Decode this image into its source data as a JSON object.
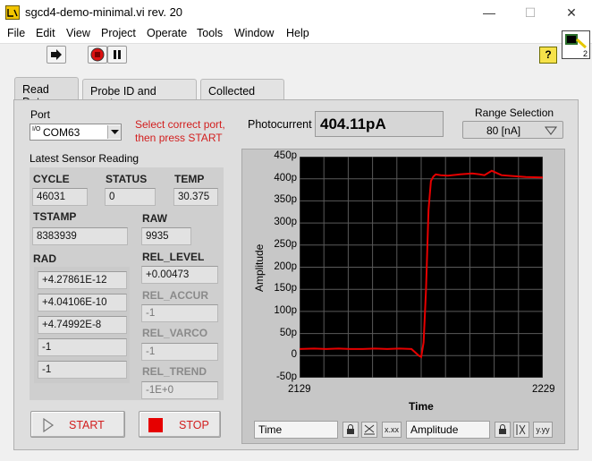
{
  "window": {
    "title": "sgcd4-demo-minimal.vi rev. 20",
    "minimize": "—",
    "maximize": "☐",
    "close": "✕"
  },
  "menu": [
    "File",
    "Edit",
    "View",
    "Project",
    "Operate",
    "Tools",
    "Window",
    "Help"
  ],
  "toolbar": {
    "help": "?",
    "icon_connector": "2"
  },
  "tabs": [
    "Read Data",
    "Probe ID and Settings",
    "Collected Data"
  ],
  "port": {
    "label": "Port",
    "value": "COM63",
    "io_glyph": "I/O",
    "hint": "Select correct port,\nthen press START"
  },
  "photocurrent": {
    "label": "Photocurrent",
    "value": "404.11pA"
  },
  "range": {
    "label": "Range Selection",
    "value": "80 [nA]"
  },
  "sensor": {
    "section_label": "Latest Sensor Reading",
    "cycle_label": "CYCLE",
    "cycle": "46031",
    "status_label": "STATUS",
    "status": "0",
    "temp_label": "TEMP",
    "temp": "30.375",
    "tstamp_label": "TSTAMP",
    "tstamp": "8383939",
    "raw_label": "RAW",
    "raw": "9935",
    "rad_label": "RAD",
    "rad": [
      "+4.27861E-12",
      "+4.04106E-10",
      "+4.74992E-8",
      "-1",
      "-1"
    ],
    "rel_level_label": "REL_LEVEL",
    "rel_level": "+0.00473",
    "rel_accur_label": "REL_ACCUR",
    "rel_accur": "-1",
    "rel_varco_label": "REL_VARCO",
    "rel_varco": "-1",
    "rel_trend_label": "REL_TREND",
    "rel_trend": "-1E+0"
  },
  "buttons": {
    "start": "START",
    "stop": "STOP"
  },
  "graph": {
    "x_legend": "Time",
    "y_legend": "Amplitude",
    "lock_glyph": "🔒",
    "x_fmt_glyph": "x.xx",
    "y_fmt_glyph": "y.yy"
  },
  "chart_data": {
    "type": "line",
    "xlabel": "Time",
    "ylabel": "Amplitude",
    "x_ticks": [
      "2129",
      "2229"
    ],
    "y_ticks": [
      "450p",
      "400p",
      "350p",
      "300p",
      "250p",
      "200p",
      "150p",
      "100p",
      "50p",
      "0",
      "-50p"
    ],
    "xlim": [
      2129,
      2229
    ],
    "ylim": [
      -50,
      450
    ],
    "y_unit": "pA",
    "grid": true,
    "series": [
      {
        "color": "#e60000",
        "x": [
          2129,
          2135,
          2140,
          2145,
          2150,
          2155,
          2160,
          2165,
          2170,
          2175,
          2178,
          2179,
          2180,
          2181,
          2182,
          2183,
          2184,
          2185,
          2187,
          2190,
          2195,
          2200,
          2203,
          2205,
          2208,
          2212,
          2217,
          2222,
          2229
        ],
        "y": [
          15,
          16,
          15,
          16,
          15,
          15,
          16,
          15,
          16,
          15,
          0,
          -3,
          30,
          150,
          330,
          395,
          405,
          410,
          408,
          407,
          410,
          412,
          410,
          408,
          418,
          408,
          406,
          404,
          403
        ]
      }
    ]
  },
  "colors": {
    "plot_bg": "#000000",
    "trace": "#e60000",
    "hint_red": "#d21e1e",
    "panel": "#f0f0f0"
  }
}
